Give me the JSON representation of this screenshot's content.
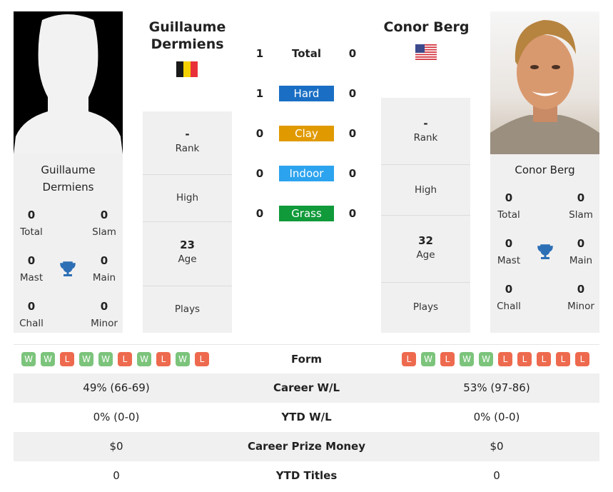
{
  "left_player": {
    "name": "Guillaume Dermiens",
    "name_lines": [
      "Guillaume",
      "Dermiens"
    ],
    "country_flag": "belgium-flag",
    "stats": {
      "total": {
        "value": "0",
        "label": "Total"
      },
      "slam": {
        "value": "0",
        "label": "Slam"
      },
      "mast": {
        "value": "0",
        "label": "Mast"
      },
      "main": {
        "value": "0",
        "label": "Main"
      },
      "chall": {
        "value": "0",
        "label": "Chall"
      },
      "minor": {
        "value": "0",
        "label": "Minor"
      }
    },
    "info": {
      "rank": {
        "value": "-",
        "label": "Rank"
      },
      "high": {
        "value": "",
        "label": "High"
      },
      "age": {
        "value": "23",
        "label": "Age"
      },
      "plays": {
        "value": "",
        "label": "Plays"
      }
    },
    "form": [
      "W",
      "W",
      "L",
      "W",
      "W",
      "L",
      "W",
      "L",
      "W",
      "L"
    ]
  },
  "right_player": {
    "name": "Conor Berg",
    "country_flag": "usa-flag",
    "stats": {
      "total": {
        "value": "0",
        "label": "Total"
      },
      "slam": {
        "value": "0",
        "label": "Slam"
      },
      "mast": {
        "value": "0",
        "label": "Mast"
      },
      "main": {
        "value": "0",
        "label": "Main"
      },
      "chall": {
        "value": "0",
        "label": "Chall"
      },
      "minor": {
        "value": "0",
        "label": "Minor"
      }
    },
    "info": {
      "rank": {
        "value": "-",
        "label": "Rank"
      },
      "high": {
        "value": "",
        "label": "High"
      },
      "age": {
        "value": "32",
        "label": "Age"
      },
      "plays": {
        "value": "",
        "label": "Plays"
      }
    },
    "form": [
      "L",
      "W",
      "L",
      "W",
      "W",
      "L",
      "L",
      "L",
      "L",
      "L"
    ]
  },
  "head_to_head": [
    {
      "label": "Total",
      "left": "1",
      "right": "0",
      "color": ""
    },
    {
      "label": "Hard",
      "left": "1",
      "right": "0",
      "color": "#1a6fc4"
    },
    {
      "label": "Clay",
      "left": "0",
      "right": "0",
      "color": "#e09a00"
    },
    {
      "label": "Indoor",
      "left": "0",
      "right": "0",
      "color": "#2ca3ee"
    },
    {
      "label": "Grass",
      "left": "0",
      "right": "0",
      "color": "#109a3a"
    }
  ],
  "comparison": {
    "form_label": "Form",
    "rows": [
      {
        "label": "Career W/L",
        "left": "49% (66-69)",
        "right": "53% (97-86)"
      },
      {
        "label": "YTD W/L",
        "left": "0% (0-0)",
        "right": "0% (0-0)"
      },
      {
        "label": "Career Prize Money",
        "left": "$0",
        "right": "$0"
      },
      {
        "label": "YTD Titles",
        "left": "0",
        "right": "0"
      }
    ]
  }
}
